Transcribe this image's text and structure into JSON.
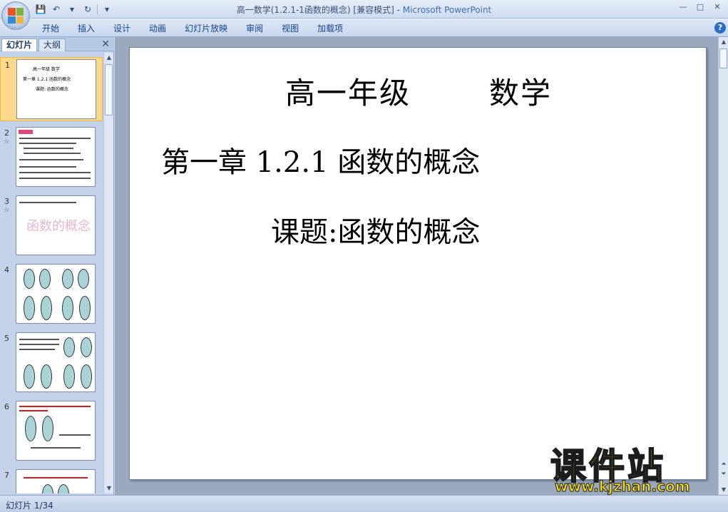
{
  "window": {
    "title": "高一数学(1.2.1-1函数的概念) [兼容模式] - ",
    "app_name": "Microsoft PowerPoint",
    "controls": [
      "—",
      "□",
      "✕"
    ]
  },
  "ribbon": {
    "tabs": [
      "开始",
      "插入",
      "设计",
      "动画",
      "幻灯片放映",
      "审阅",
      "视图",
      "加载项"
    ],
    "help": "?"
  },
  "left_pane": {
    "tabs": [
      "幻灯片",
      "大纲"
    ],
    "close": "✕",
    "thumbnails": [
      {
        "num": "1",
        "lines": [
          "高一年级      数学",
          "第一章  1.2.1  函数的概念",
          "课题: 函数的概念"
        ]
      },
      {
        "num": "2",
        "star": "☆"
      },
      {
        "num": "3",
        "star": "☆",
        "caption": "函数的概念"
      },
      {
        "num": "4"
      },
      {
        "num": "5"
      },
      {
        "num": "6"
      },
      {
        "num": "7"
      }
    ]
  },
  "slide": {
    "line1_left": "高一年级",
    "line1_right": "数学",
    "line2": "第一章  1.2.1  函数的概念",
    "line3": "课题:函数的概念"
  },
  "watermark": {
    "brand": "课件站",
    "url": "www.kjzhan.com"
  },
  "status": {
    "slide_indicator": "幻灯片 1/34"
  },
  "colors": {
    "ribbon_text": "#15428b",
    "selected_thumb": "#fbd88a",
    "watermark_yellow": "#f6de1c"
  }
}
